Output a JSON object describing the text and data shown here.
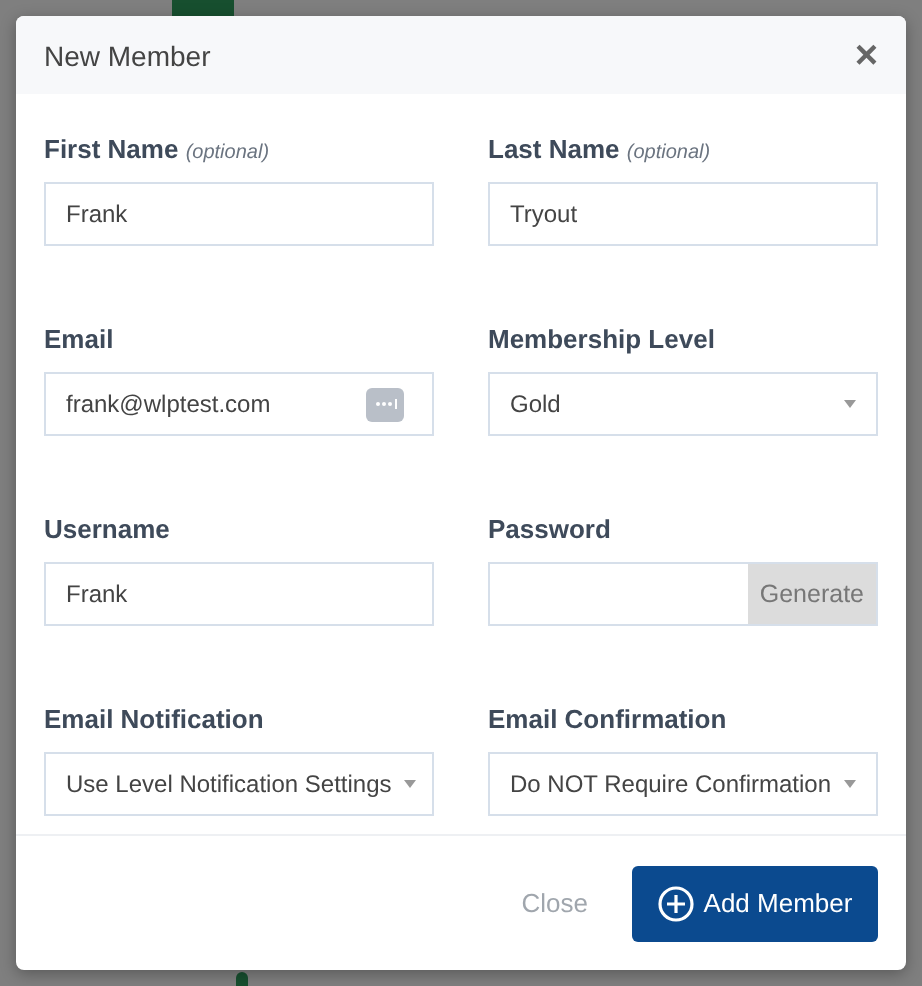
{
  "dialog": {
    "title": "New Member",
    "close": "×",
    "fields": [
      {
        "kind": "text",
        "label": "First Name",
        "hint": "(optional)",
        "value": "Frank"
      },
      {
        "kind": "text",
        "label": "Last Name",
        "hint": "(optional)",
        "value": "Tryout"
      },
      {
        "kind": "email",
        "label": "Email",
        "value": "frank@wlptest.com"
      },
      {
        "kind": "select",
        "label": "Membership Level",
        "value": "Gold"
      },
      {
        "kind": "text",
        "label": "Username",
        "value": "Frank"
      },
      {
        "kind": "password",
        "label": "Password",
        "action": "Generate"
      },
      {
        "kind": "select",
        "label": "Email Notification",
        "value": "Use Level Notification Settings"
      },
      {
        "kind": "select",
        "label": "Email Confirmation",
        "value": "Do NOT Require Confirmation"
      }
    ],
    "buttons": [
      {
        "kind": "link",
        "label": "Close"
      },
      {
        "kind": "primary",
        "label": "Add Member"
      }
    ]
  }
}
